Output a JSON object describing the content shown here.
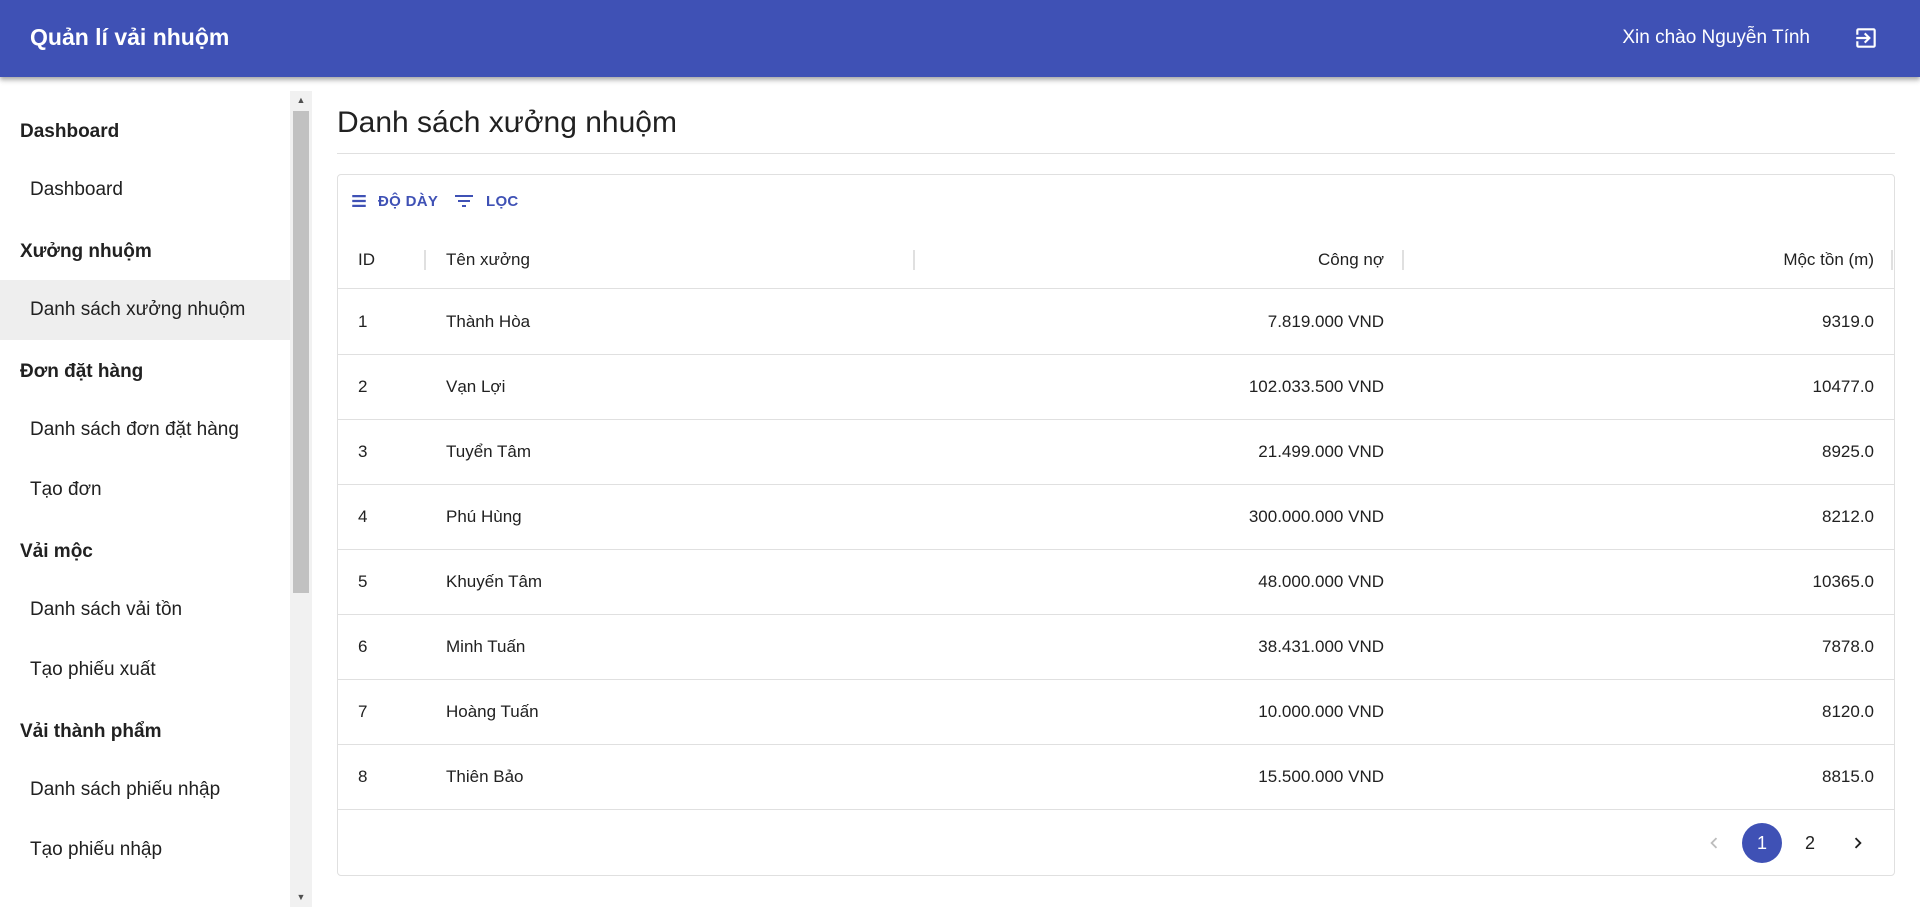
{
  "app": {
    "title": "Quản lí vải nhuộm",
    "greeting": "Xin chào Nguyễn Tính",
    "logout_icon": "logout-icon"
  },
  "sidebar": {
    "groups": [
      {
        "label": "Dashboard",
        "items": [
          {
            "label": "Dashboard"
          }
        ]
      },
      {
        "label": "Xưởng nhuộm",
        "items": [
          {
            "label": "Danh sách xưởng nhuộm",
            "active": true
          }
        ]
      },
      {
        "label": "Đơn đặt hàng",
        "items": [
          {
            "label": "Danh sách đơn đặt hàng"
          },
          {
            "label": "Tạo đơn"
          }
        ]
      },
      {
        "label": "Vải mộc",
        "items": [
          {
            "label": "Danh sách vải tồn"
          },
          {
            "label": "Tạo phiếu xuất"
          }
        ]
      },
      {
        "label": "Vải thành phẩm",
        "items": [
          {
            "label": "Danh sách phiếu nhập"
          },
          {
            "label": "Tạo phiếu nhập"
          }
        ]
      }
    ]
  },
  "main": {
    "title": "Danh sách xưởng nhuộm",
    "toolbar": {
      "density_label": "ĐỘ DÀY",
      "density_icon": "density-icon",
      "filter_label": "LỌC",
      "filter_icon": "filter-icon"
    },
    "table": {
      "columns": [
        "ID",
        "Tên xưởng",
        "Công nợ",
        "Mộc tồn (m)"
      ],
      "rows": [
        [
          "1",
          "Thành Hòa",
          "7.819.000 VND",
          "9319.0"
        ],
        [
          "2",
          "Vạn Lợi",
          "102.033.500 VND",
          "10477.0"
        ],
        [
          "3",
          "Tuyển Tâm",
          "21.499.000 VND",
          "8925.0"
        ],
        [
          "4",
          "Phú Hùng",
          "300.000.000 VND",
          "8212.0"
        ],
        [
          "5",
          "Khuyến Tâm",
          "48.000.000 VND",
          "10365.0"
        ],
        [
          "6",
          "Minh Tuấn",
          "38.431.000 VND",
          "7878.0"
        ],
        [
          "7",
          "Hoàng Tuấn",
          "10.000.000 VND",
          "8120.0"
        ],
        [
          "8",
          "Thiên Bảo",
          "15.500.000 VND",
          "8815.0"
        ]
      ]
    },
    "pagination": {
      "pages": [
        "1",
        "2"
      ],
      "current": "1",
      "prev_icon": "chevron-left-icon",
      "next_icon": "chevron-right-icon"
    }
  },
  "colors": {
    "primary": "#3f51b5",
    "active_nav_bg": "#eeeeee",
    "divider": "#e0e0e0"
  }
}
